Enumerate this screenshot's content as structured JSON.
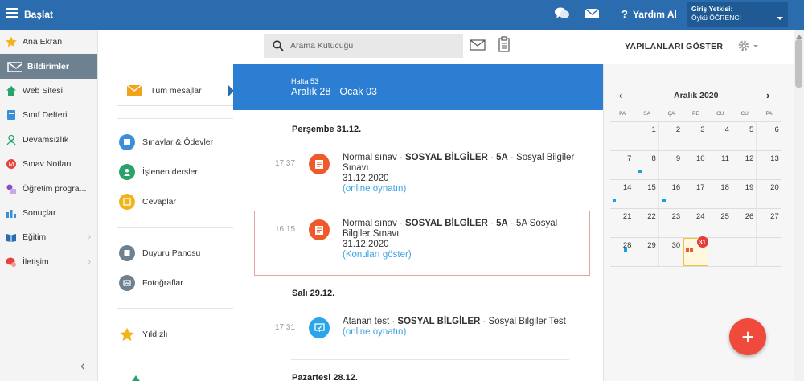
{
  "topbar": {
    "start_label": "Başlat",
    "help_label": "Yardım Al",
    "auth_label": "Giriş Yetkisi:",
    "auth_user": "Öykü ÖĞRENCİ"
  },
  "nav": {
    "items": [
      {
        "label": "Ana Ekran",
        "icon": "star-icon",
        "color": "#f3b31b"
      },
      {
        "label": "Bildirimler",
        "icon": "mail-icon",
        "color": "#ffffff"
      },
      {
        "label": "Web Sitesi",
        "icon": "home-icon",
        "color": "#2aa36b"
      },
      {
        "label": "Sınıf Defteri",
        "icon": "notebook-icon",
        "color": "#3b8fd9"
      },
      {
        "label": "Devamsızlık",
        "icon": "person-icon",
        "color": "#2aa36b"
      },
      {
        "label": "Sınav Notları",
        "icon": "grade-icon",
        "color": "#e8423c"
      },
      {
        "label": "Öğretim progra...",
        "icon": "curriculum-icon",
        "color": "#8a4ec2"
      },
      {
        "label": "Sonuçlar",
        "icon": "bar-chart-icon",
        "color": "#3b8fd9"
      },
      {
        "label": "Eğitim",
        "icon": "book-icon",
        "color": "#2b6cae"
      },
      {
        "label": "İletişim",
        "icon": "chat-icon",
        "color": "#e8423c"
      }
    ]
  },
  "secondary": {
    "all_messages": "Tüm mesajlar",
    "items": [
      {
        "label": "Sınavlar & Ödevler",
        "color": "#3b8fd9"
      },
      {
        "label": "İşlenen dersler",
        "color": "#2aa36b"
      },
      {
        "label": "Cevaplar",
        "color": "#f3b31b"
      },
      {
        "label": "Duyuru Panosu",
        "color": "#6e8190"
      },
      {
        "label": "Fotoğraflar",
        "color": "#6e8190"
      },
      {
        "label": "Yıldızlı",
        "color": "#f3b31b"
      }
    ]
  },
  "header": {
    "search_placeholder": "Arama Kutucuğu",
    "show_done": "YAPILANLARI GÖSTER"
  },
  "feed": {
    "week_label": "Hafta 53",
    "week_range": "Aralık 28 - Ocak 03",
    "days": [
      {
        "title": "Perşembe 31.12."
      },
      {
        "title": "Salı 29.12."
      },
      {
        "title": "Pazartesi 28.12."
      }
    ],
    "events": [
      {
        "time": "17:37",
        "type": "Normal sınav",
        "subject": "SOSYAL BİLGİLER",
        "class": "5A",
        "rest": "Sosyal Bilgiler Sınavı",
        "date": "31.12.2020",
        "link": "(online oynatın)"
      },
      {
        "time": "16:15",
        "type": "Normal sınav",
        "subject": "SOSYAL BİLGİLER",
        "class": "5A",
        "rest": "5A Sosyal Bilgiler Sınavı",
        "date": "31.12.2020",
        "link": "(Konuları göster)"
      },
      {
        "time": "17:31",
        "type": "Atanan test",
        "subject": "SOSYAL BİLGİLER",
        "rest": "Sosyal Bilgiler Test",
        "link": "(online oynatın)"
      }
    ]
  },
  "calendar": {
    "month": "Aralık 2020",
    "dow": [
      "PA",
      "SA",
      "ÇA",
      "PE",
      "CU",
      "CU",
      "PA"
    ],
    "weeks": [
      [
        "",
        "1",
        "2",
        "3",
        "4",
        "5",
        "6"
      ],
      [
        "7",
        "8",
        "9",
        "10",
        "11",
        "12",
        "13"
      ],
      [
        "14",
        "15",
        "16",
        "17",
        "18",
        "19",
        "20"
      ],
      [
        "21",
        "22",
        "23",
        "24",
        "25",
        "26",
        "27"
      ],
      [
        "28",
        "29",
        "30",
        "31",
        "",
        "",
        ""
      ]
    ],
    "today_badge": "31"
  },
  "fab_label": "+"
}
